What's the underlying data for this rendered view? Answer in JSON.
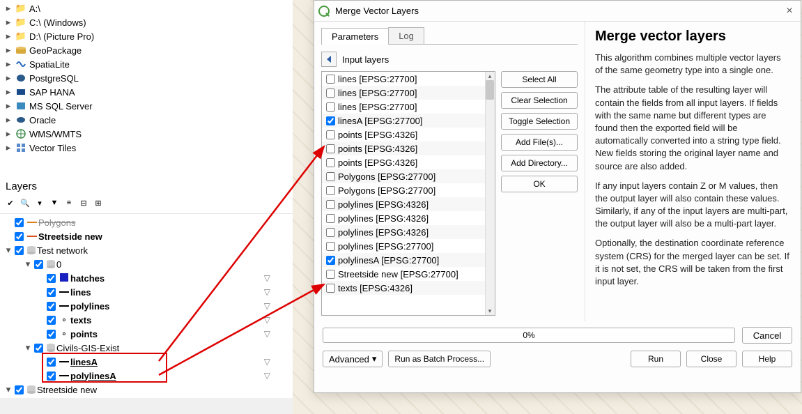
{
  "browser": {
    "items": [
      {
        "label": "A:\\",
        "icon": "folder"
      },
      {
        "label": "C:\\ (Windows)",
        "icon": "folder"
      },
      {
        "label": "D:\\ (Picture Pro)",
        "icon": "folder"
      },
      {
        "label": "GeoPackage",
        "icon": "geopackage"
      },
      {
        "label": "SpatiaLite",
        "icon": "spatialite"
      },
      {
        "label": "PostgreSQL",
        "icon": "postgres"
      },
      {
        "label": "SAP HANA",
        "icon": "hana"
      },
      {
        "label": "MS SQL Server",
        "icon": "mssql"
      },
      {
        "label": "Oracle",
        "icon": "oracle"
      },
      {
        "label": "WMS/WMTS",
        "icon": "wms"
      },
      {
        "label": "Vector Tiles",
        "icon": "vectortiles"
      }
    ]
  },
  "layers_panel_title": "Layers",
  "layer_tree": {
    "polygons": {
      "label": "Polygons"
    },
    "streetside_new": {
      "label": "Streetside new"
    },
    "test_network": {
      "label": "Test network"
    },
    "group_0": {
      "label": "0"
    },
    "hatches": {
      "label": "hatches"
    },
    "lines": {
      "label": "lines"
    },
    "polylines": {
      "label": "polylines"
    },
    "texts": {
      "label": "texts"
    },
    "points": {
      "label": "points"
    },
    "civils": {
      "label": "Civils-GIS-Exist"
    },
    "linesA": {
      "label": "linesA"
    },
    "polylinesA": {
      "label": "polylinesA"
    },
    "streetside_new_2": {
      "label": "Streetside new"
    }
  },
  "dialog": {
    "title": "Merge Vector Layers",
    "tabs": {
      "parameters": "Parameters",
      "log": "Log"
    },
    "section": "Input layers",
    "list": [
      {
        "label": "lines [EPSG:27700]",
        "checked": false
      },
      {
        "label": "lines [EPSG:27700]",
        "checked": false
      },
      {
        "label": "lines [EPSG:27700]",
        "checked": false
      },
      {
        "label": "linesA [EPSG:27700]",
        "checked": true
      },
      {
        "label": "points [EPSG:4326]",
        "checked": false
      },
      {
        "label": "points [EPSG:4326]",
        "checked": false
      },
      {
        "label": "points [EPSG:4326]",
        "checked": false
      },
      {
        "label": "Polygons [EPSG:27700]",
        "checked": false
      },
      {
        "label": "Polygons [EPSG:27700]",
        "checked": false
      },
      {
        "label": "polylines [EPSG:4326]",
        "checked": false
      },
      {
        "label": "polylines [EPSG:4326]",
        "checked": false
      },
      {
        "label": "polylines [EPSG:4326]",
        "checked": false
      },
      {
        "label": "polylines [EPSG:27700]",
        "checked": false
      },
      {
        "label": "polylinesA [EPSG:27700]",
        "checked": true
      },
      {
        "label": "Streetside new [EPSG:27700]",
        "checked": false
      },
      {
        "label": "texts [EPSG:4326]",
        "checked": false
      }
    ],
    "buttons": {
      "select_all": "Select All",
      "clear_selection": "Clear Selection",
      "toggle_selection": "Toggle Selection",
      "add_files": "Add File(s)...",
      "add_directory": "Add Directory...",
      "ok": "OK"
    },
    "help": {
      "title": "Merge vector layers",
      "p1": "This algorithm combines multiple vector layers of the same geometry type into a single one.",
      "p2": "The attribute table of the resulting layer will contain the fields from all input layers. If fields with the same name but different types are found then the exported field will be automatically converted into a string type field. New fields storing the original layer name and source are also added.",
      "p3": "If any input layers contain Z or M values, then the output layer will also contain these values. Similarly, if any of the input layers are multi-part, the output layer will also be a multi-part layer.",
      "p4": "Optionally, the destination coordinate reference system (CRS) for the merged layer can be set. If it is not set, the CRS will be taken from the first input layer."
    },
    "progress": "0%",
    "bottom": {
      "advanced": "Advanced",
      "batch": "Run as Batch Process...",
      "run": "Run",
      "close": "Close",
      "help": "Help",
      "cancel": "Cancel"
    }
  }
}
